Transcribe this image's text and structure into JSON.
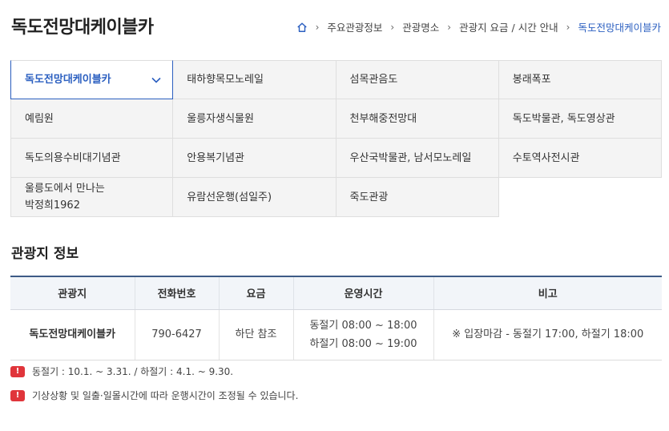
{
  "page": {
    "title": "독도전망대케이블카"
  },
  "breadcrumb": {
    "items": [
      "주요관광정보",
      "관광명소",
      "관광지 요금 / 시간 안내"
    ],
    "current": "독도전망대케이블카"
  },
  "tabs": {
    "active": "독도전망대케이블카",
    "row1": [
      "태하향목모노레일",
      "섬목관음도",
      "봉래폭포"
    ],
    "row2": [
      "예림원",
      "울릉자생식물원",
      "천부해중전망대",
      "독도박물관, 독도영상관"
    ],
    "row3": [
      "독도의용수비대기념관",
      "안용복기념관",
      "우산국박물관, 남서모노레일",
      "수토역사전시관"
    ],
    "row4a_line1": "울릉도에서 만나는",
    "row4a_line2": "박정희1962",
    "row4": [
      "유람선운행(섬일주)",
      "죽도관광"
    ]
  },
  "section": {
    "title": "관광지 정보"
  },
  "table": {
    "headers": [
      "관광지",
      "전화번호",
      "요금",
      "운영시간",
      "비고"
    ],
    "row": {
      "name": "독도전망대케이블카",
      "phone": "790-6427",
      "fee": "하단 참조",
      "hours_winter": "동절기 08:00 ~ 18:00",
      "hours_summer": "하절기 08:00 ~ 19:00",
      "note": "※ 입장마감 - 동절기 17:00, 하절기 18:00"
    }
  },
  "notes": [
    {
      "icon": "alert-icon",
      "symbol": "!",
      "text": "동절기 : 10.1. ~ 3.31. / 하절기 : 4.1. ~ 9.30."
    },
    {
      "icon": "alert-icon",
      "symbol": "!",
      "text": "기상상황 및 일출·일몰시간에 따라 운행시간이 조정될 수 있습니다."
    }
  ],
  "colors": {
    "accent": "#2b5fc0",
    "alert": "#e0353b",
    "table_header_border": "#3d5b86"
  }
}
